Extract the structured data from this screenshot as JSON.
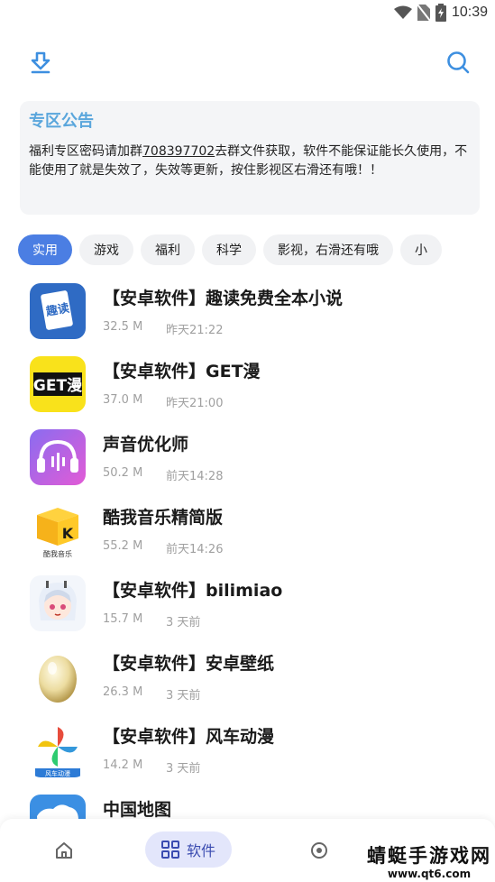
{
  "status_bar": {
    "time": "10:39"
  },
  "notice": {
    "title": "专区公告",
    "body_before": "福利专区密码请加群",
    "group_number": "708397702",
    "body_after": "去群文件获取，软件不能保证能长久使用，不能使用了就是失效了，失效等更新，按住影视区右滑还有哦！！"
  },
  "categories": [
    "实用",
    "游戏",
    "福利",
    "科学",
    "影视，右滑还有哦",
    "小"
  ],
  "active_category": "实用",
  "apps": [
    {
      "title": "【安卓软件】趣读免费全本小说",
      "size": "32.5 M",
      "date": "昨天21:22",
      "icon": "qudu-book-icon",
      "icon_text": "趣读"
    },
    {
      "title": "【安卓软件】GET漫",
      "size": "37.0 M",
      "date": "昨天21:00",
      "icon": "getman-logo-icon",
      "icon_text": "GET漫"
    },
    {
      "title": "声音优化师",
      "size": "50.2 M",
      "date": "前天14:28",
      "icon": "voice-headphone-icon"
    },
    {
      "title": "酷我音乐精简版",
      "size": "55.2 M",
      "date": "前天14:26",
      "icon": "kuwo-box-icon",
      "icon_text": "酷我音乐"
    },
    {
      "title": "【安卓软件】bilimiao",
      "size": "15.7 M",
      "date": "3 天前",
      "icon": "anime-girl-icon"
    },
    {
      "title": "【安卓软件】安卓壁纸",
      "size": "26.3 M",
      "date": "3 天前",
      "icon": "egg-icon"
    },
    {
      "title": "【安卓软件】风车动漫",
      "size": "14.2 M",
      "date": "3 天前",
      "icon": "pinwheel-icon",
      "icon_text": "风车动漫"
    },
    {
      "title": "中国地图",
      "size": "",
      "date": "",
      "icon": "china-map-icon"
    }
  ],
  "bottom_nav": {
    "software_label": "软件"
  },
  "watermark": {
    "title": "蜻蜓手游戏网",
    "url": "www.qt6.com"
  },
  "colors": {
    "accent": "#4b7ee3",
    "icon_blue": "#3d8fe0",
    "notice_title": "#5aa6dc"
  }
}
